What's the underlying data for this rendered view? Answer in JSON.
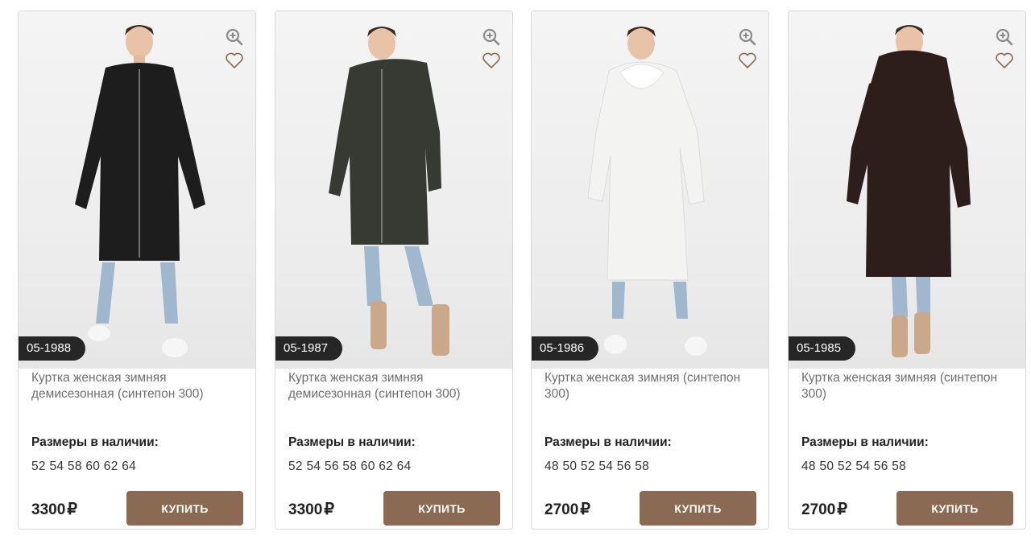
{
  "products": [
    {
      "sku": "05-1988",
      "title": "Куртка женская зимняя демисезонная (синтепон 300)",
      "sizes_label": "Размеры в наличии:",
      "sizes": "52 54 58 60 62 64",
      "price": "3300",
      "currency": "₽",
      "buy_label": "КУПИТЬ",
      "coat_color": "#1d1d1d"
    },
    {
      "sku": "05-1987",
      "title": "Куртка женская зимняя демисезонная (синтепон 300)",
      "sizes_label": "Размеры в наличии:",
      "sizes": "52 54 56 58 60 62 64",
      "price": "3300",
      "currency": "₽",
      "buy_label": "КУПИТЬ",
      "coat_color": "#363a33"
    },
    {
      "sku": "05-1986",
      "title": "Куртка женская зимняя (синтепон 300)",
      "sizes_label": "Размеры в наличии:",
      "sizes": "48 50 52 54 56 58",
      "price": "2700",
      "currency": "₽",
      "buy_label": "КУПИТЬ",
      "coat_color": "#f3f3f1"
    },
    {
      "sku": "05-1985",
      "title": "Куртка женская зимняя (синтепон 300)",
      "sizes_label": "Размеры в наличии:",
      "sizes": "48 50 52 54 56 58",
      "price": "2700",
      "currency": "₽",
      "buy_label": "КУПИТЬ",
      "coat_color": "#2e1e1b"
    }
  ],
  "icons": {
    "zoom": "zoom-in-icon",
    "favorite": "heart-icon"
  },
  "colors": {
    "button": "#8a6a52",
    "sku_badge": "#262626",
    "icon": "#8a6a52"
  }
}
